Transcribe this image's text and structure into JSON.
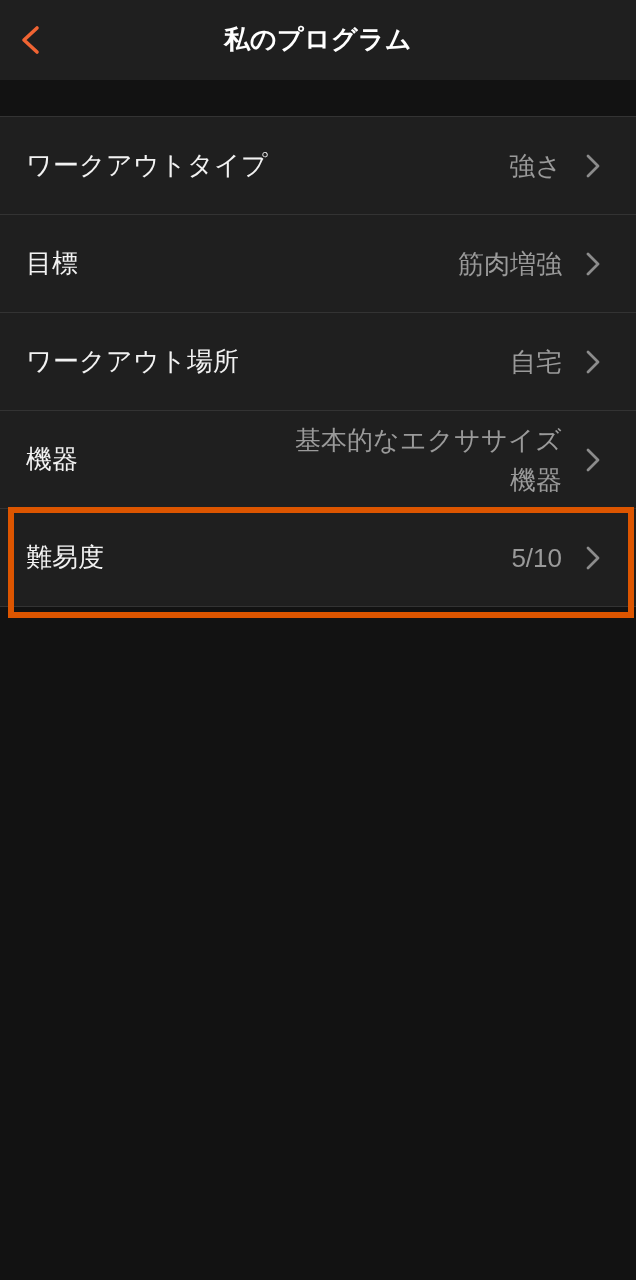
{
  "header": {
    "title": "私のプログラム"
  },
  "settings": [
    {
      "label": "ワークアウトタイプ",
      "value": "強さ",
      "highlighted": false
    },
    {
      "label": "目標",
      "value": "筋肉増強",
      "highlighted": false
    },
    {
      "label": "ワークアウト場所",
      "value": "自宅",
      "highlighted": false
    },
    {
      "label": "機器",
      "value": "基本的なエクササイズ機器",
      "highlighted": false
    },
    {
      "label": "難易度",
      "value": "5/10",
      "highlighted": true
    }
  ]
}
